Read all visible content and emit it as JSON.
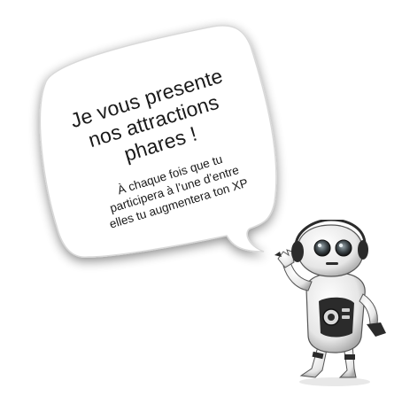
{
  "bubble": {
    "headline_line1": "Je vous presente",
    "headline_line2": "nos attractions",
    "headline_line3": "phares !",
    "body_line1": "À chaque fois que tu",
    "body_line2": "participera à l’une d’entre",
    "body_line3": "elles tu augmentera ton XP"
  },
  "icons": {
    "robot": "robot-illustration"
  },
  "colors": {
    "bubble_fill": "#ffffff",
    "bubble_shadow": "#bdbdbd",
    "text": "#1a1a1a",
    "robot_body": "#f2f2f2",
    "robot_dark": "#2b2b2b"
  }
}
